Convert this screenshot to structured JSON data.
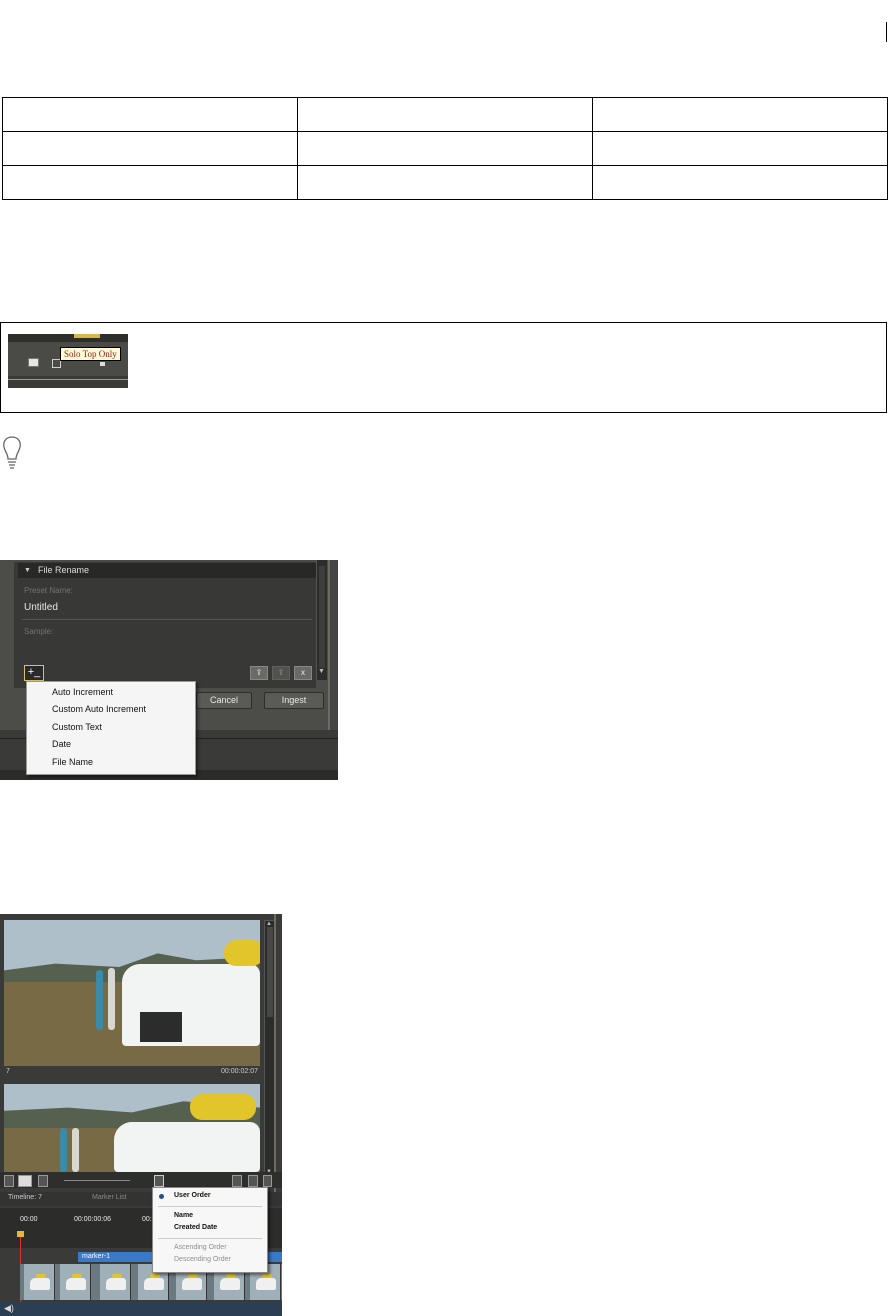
{
  "table": {
    "rows": 3,
    "cols": 3
  },
  "note": {
    "tooltip": "Solo Top Only",
    "icon": "lightbulb-icon"
  },
  "file_rename": {
    "header": "File Rename",
    "preset_name_label": "Preset Name:",
    "preset_name_value": "Untitled",
    "sample_label": "Sample:",
    "add_button": "+_",
    "delete_label": "x",
    "cancel": "Cancel",
    "ingest": "Ingest",
    "menu": [
      "Auto Increment",
      "Custom Auto Increment",
      "Custom Text",
      "Date",
      "File Name"
    ]
  },
  "video": {
    "clip_number": "7",
    "clip_duration": "00:00:02:07",
    "timeline_tab": "Timeline: 7",
    "marker_tab": "Marker List",
    "ruler": [
      "00:00",
      "00:00:00:06",
      "00:0"
    ],
    "marker": "marker-1",
    "sort_menu": {
      "user_order": "User Order",
      "name": "Name",
      "created_date": "Created Date",
      "ascending": "Ascending Order",
      "descending": "Descending Order"
    }
  },
  "colors": {
    "panel_dark": "#383836",
    "accent_gold": "#d8c070",
    "marker_blue": "#3a78c8"
  }
}
